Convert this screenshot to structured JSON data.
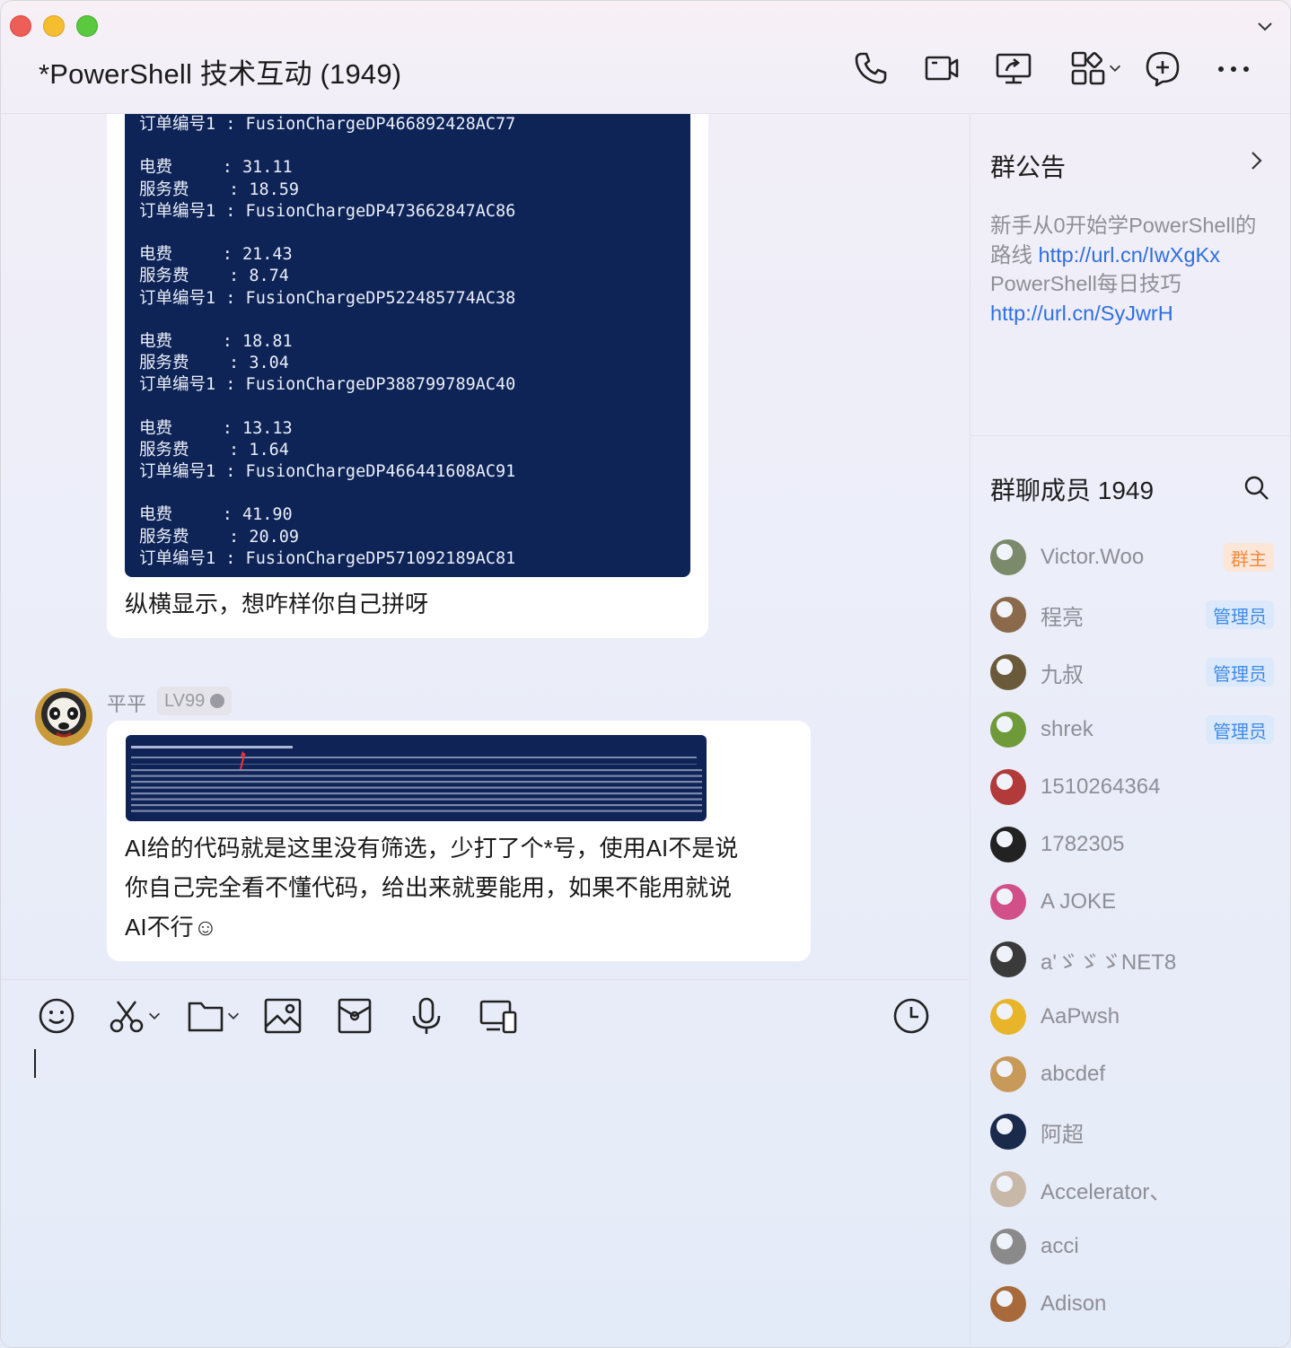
{
  "window": {
    "title": "*PowerShell 技术互动 (1949)"
  },
  "toolbar": {
    "icons": [
      "phone-icon",
      "video-icon",
      "screen-share-icon",
      "apps-icon",
      "add-chat-icon",
      "more-icon"
    ]
  },
  "chat": {
    "message1": {
      "terminal_lines": [
        "订单编号1 : FusionChargeDP466892428AC77",
        "",
        "电费     : 31.11",
        "服务费    : 18.59",
        "订单编号1 : FusionChargeDP473662847AC86",
        "",
        "电费     : 21.43",
        "服务费    : 8.74",
        "订单编号1 : FusionChargeDP522485774AC38",
        "",
        "电费     : 18.81",
        "服务费    : 3.04",
        "订单编号1 : FusionChargeDP388799789AC40",
        "",
        "电费     : 13.13",
        "服务费    : 1.64",
        "订单编号1 : FusionChargeDP466441608AC91",
        "",
        "电费     : 41.90",
        "服务费    : 20.09",
        "订单编号1 : FusionChargeDP571092189AC81"
      ],
      "text": "纵横显示，想咋样你自己拼呀"
    },
    "message2": {
      "sender": "平平",
      "level": "LV99",
      "text_lines": [
        "AI给的代码就是这里没有筛选，少打了个*号，使用AI不是说",
        "你自己完全看不懂代码，给出来就要能用，如果不能用就说",
        "AI不行☺"
      ]
    }
  },
  "composer": {
    "icons": [
      "emoji-icon",
      "scissors-icon",
      "folder-icon",
      "image-icon",
      "envelope-icon",
      "microphone-icon",
      "device-icon",
      "history-icon"
    ]
  },
  "side": {
    "notice": {
      "title": "群公告",
      "line1": "新手从0开始学PowerShell的路线 ",
      "link1": "http://url.cn/IwXgKx",
      "line2": "PowerShell每日技巧 ",
      "link2": "http://url.cn/SyJwrH"
    },
    "members": {
      "title": "群聊成员 1949",
      "list": [
        {
          "name": "Victor.Woo",
          "badge": "群主",
          "badge_type": "owner",
          "color": "#7a8a6a"
        },
        {
          "name": "程亮",
          "badge": "管理员",
          "badge_type": "admin",
          "color": "#8a6a4a"
        },
        {
          "name": "九叔",
          "badge": "管理员",
          "badge_type": "admin",
          "color": "#6a5a3a"
        },
        {
          "name": "shrek",
          "badge": "管理员",
          "badge_type": "admin",
          "color": "#6f9a3a"
        },
        {
          "name": "1510264364",
          "badge": "",
          "badge_type": "",
          "color": "#b23a3a"
        },
        {
          "name": "1782305",
          "badge": "",
          "badge_type": "",
          "color": "#222222"
        },
        {
          "name": "A JOKE",
          "badge": "",
          "badge_type": "",
          "color": "#d2508a"
        },
        {
          "name": "a'ゞゞゞNET8",
          "badge": "",
          "badge_type": "",
          "color": "#3a3a3a"
        },
        {
          "name": "AaPwsh",
          "badge": "",
          "badge_type": "",
          "color": "#e8b52a"
        },
        {
          "name": "abcdef",
          "badge": "",
          "badge_type": "",
          "color": "#c89a5a"
        },
        {
          "name": "阿超",
          "badge": "",
          "badge_type": "",
          "color": "#1a2a4a"
        },
        {
          "name": "Accelerator、",
          "badge": "",
          "badge_type": "",
          "color": "#c8b8a8"
        },
        {
          "name": "acci",
          "badge": "",
          "badge_type": "",
          "color": "#8a8a8a"
        },
        {
          "name": "Adison",
          "badge": "",
          "badge_type": "",
          "color": "#a86a3a"
        }
      ]
    }
  }
}
